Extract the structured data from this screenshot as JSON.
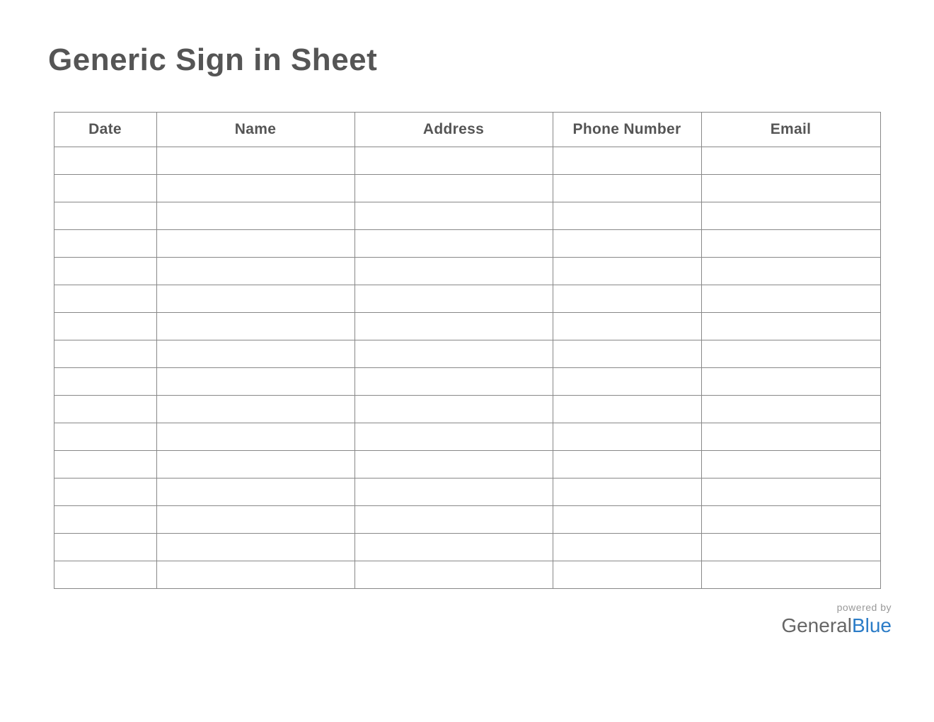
{
  "title": "Generic Sign in Sheet",
  "columns": {
    "date": "Date",
    "name": "Name",
    "address": "Address",
    "phone": "Phone Number",
    "email": "Email"
  },
  "rows": [
    {
      "date": "",
      "name": "",
      "address": "",
      "phone": "",
      "email": ""
    },
    {
      "date": "",
      "name": "",
      "address": "",
      "phone": "",
      "email": ""
    },
    {
      "date": "",
      "name": "",
      "address": "",
      "phone": "",
      "email": ""
    },
    {
      "date": "",
      "name": "",
      "address": "",
      "phone": "",
      "email": ""
    },
    {
      "date": "",
      "name": "",
      "address": "",
      "phone": "",
      "email": ""
    },
    {
      "date": "",
      "name": "",
      "address": "",
      "phone": "",
      "email": ""
    },
    {
      "date": "",
      "name": "",
      "address": "",
      "phone": "",
      "email": ""
    },
    {
      "date": "",
      "name": "",
      "address": "",
      "phone": "",
      "email": ""
    },
    {
      "date": "",
      "name": "",
      "address": "",
      "phone": "",
      "email": ""
    },
    {
      "date": "",
      "name": "",
      "address": "",
      "phone": "",
      "email": ""
    },
    {
      "date": "",
      "name": "",
      "address": "",
      "phone": "",
      "email": ""
    },
    {
      "date": "",
      "name": "",
      "address": "",
      "phone": "",
      "email": ""
    },
    {
      "date": "",
      "name": "",
      "address": "",
      "phone": "",
      "email": ""
    },
    {
      "date": "",
      "name": "",
      "address": "",
      "phone": "",
      "email": ""
    },
    {
      "date": "",
      "name": "",
      "address": "",
      "phone": "",
      "email": ""
    },
    {
      "date": "",
      "name": "",
      "address": "",
      "phone": "",
      "email": ""
    }
  ],
  "footer": {
    "powered_by": "powered by",
    "brand_general": "General",
    "brand_blue": "Blue"
  }
}
